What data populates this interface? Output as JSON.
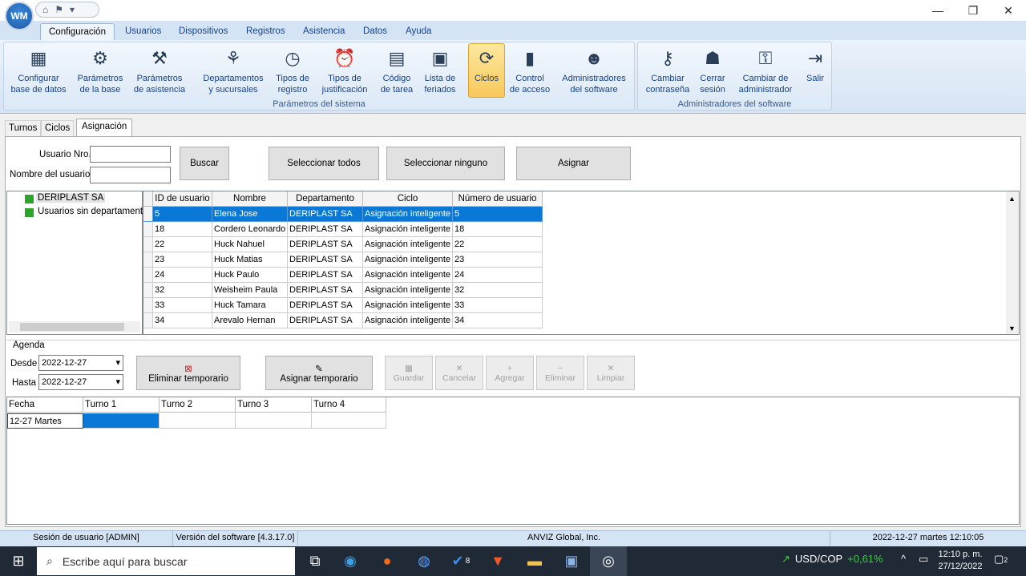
{
  "app": {
    "logo_text": "WM",
    "min": "—",
    "max": "❐",
    "close": "✕"
  },
  "menu": [
    "Configuración",
    "Usuarios",
    "Dispositivos",
    "Registros",
    "Asistencia",
    "Datos",
    "Ayuda"
  ],
  "ribbon": {
    "buttons": [
      {
        "label1": "Configurar",
        "label2": "base de datos",
        "icon": "database-icon"
      },
      {
        "label1": "Parámetros",
        "label2": "de la base",
        "icon": "base-settings-icon"
      },
      {
        "label1": "Parámetros",
        "label2": "de asistencia",
        "icon": "attendance-settings-icon"
      },
      {
        "label1": "Departamentos",
        "label2": "y sucursales",
        "icon": "org-chart-icon"
      },
      {
        "label1": "Tipos de",
        "label2": "registro",
        "icon": "clock-icon"
      },
      {
        "label1": "Tipos de",
        "label2": "justificación",
        "icon": "alarm-clock-icon"
      },
      {
        "label1": "Código",
        "label2": "de tarea",
        "icon": "task-code-icon"
      },
      {
        "label1": "Lista de",
        "label2": "feriados",
        "icon": "calendar-icon"
      },
      {
        "label1": "Ciclos",
        "label2": "",
        "icon": "cycles-icon"
      },
      {
        "label1": "Control",
        "label2": "de acceso",
        "icon": "door-icon"
      },
      {
        "label1": "Administradores",
        "label2": "del software",
        "icon": "admin-icon"
      },
      {
        "label1": "Cambiar",
        "label2": "contraseña",
        "icon": "key-icon"
      },
      {
        "label1": "Cerrar",
        "label2": "sesión",
        "icon": "lock-user-icon"
      },
      {
        "label1": "Cambiar de",
        "label2": "administrador",
        "icon": "switch-admin-icon"
      },
      {
        "label1": "Salir",
        "label2": "",
        "icon": "exit-icon"
      }
    ],
    "group1": "Parámetros del sistema",
    "group2": "Administradores del software"
  },
  "tabs": [
    "Turnos",
    "Ciclos",
    "Asignación"
  ],
  "search": {
    "user_no_label": "Usuario Nro.",
    "user_name_label": "Nombre del usuario",
    "user_no_value": "",
    "user_name_value": "",
    "buscar": "Buscar",
    "sel_all": "Seleccionar todos",
    "sel_none": "Seleccionar ninguno",
    "assign": "Asignar"
  },
  "tree": [
    "DERIPLAST SA",
    "Usuarios sin departamento"
  ],
  "grid": {
    "headers": [
      "ID de usuario",
      "Nombre",
      "Departamento",
      "Ciclo",
      "Número de usuario"
    ],
    "rows": [
      [
        "5",
        "Elena Jose",
        "DERIPLAST SA",
        "Asignación inteligente",
        "5"
      ],
      [
        "18",
        "Cordero Leonardo",
        "DERIPLAST SA",
        "Asignación inteligente",
        "18"
      ],
      [
        "22",
        "Huck Nahuel",
        "DERIPLAST SA",
        "Asignación inteligente",
        "22"
      ],
      [
        "23",
        "Huck Matias",
        "DERIPLAST SA",
        "Asignación inteligente",
        "23"
      ],
      [
        "24",
        "Huck Paulo",
        "DERIPLAST SA",
        "Asignación inteligente",
        "24"
      ],
      [
        "32",
        "Weisheim Paula",
        "DERIPLAST SA",
        "Asignación inteligente",
        "32"
      ],
      [
        "33",
        "Huck Tamara",
        "DERIPLAST SA",
        "Asignación inteligente",
        "33"
      ],
      [
        "34",
        "Arevalo Hernan",
        "DERIPLAST SA",
        "Asignación inteligente",
        "34"
      ]
    ]
  },
  "agenda": {
    "title": "Agenda",
    "desde": "Desde",
    "hasta": "Hasta",
    "desde_val": "2022-12-27",
    "hasta_val": "2022-12-27",
    "del_temp": "Eliminar temporario",
    "assign_temp": "Asignar temporario",
    "disabled": [
      "Guardar",
      "Cancelar",
      "Agregar",
      "Eliminar",
      "Limpiar"
    ],
    "headers": [
      "Fecha",
      "Turno 1",
      "Turno 2",
      "Turno 3",
      "Turno 4"
    ],
    "row": [
      "12-27 Martes",
      "",
      "",
      "",
      ""
    ]
  },
  "status": {
    "session": "Sesión de usuario  [ADMIN]",
    "version": "Versión del software  [4.3.17.0]",
    "company": "ANVIZ Global, Inc.",
    "datetime": "2022-12-27 martes 12:10:05"
  },
  "taskbar": {
    "search": "Escribe aquí para buscar",
    "fx": "USD/COP",
    "fx_change": "+0,61%",
    "time": "12:10 p. m.",
    "date": "27/12/2022",
    "notif": "2",
    "badge": "8"
  }
}
